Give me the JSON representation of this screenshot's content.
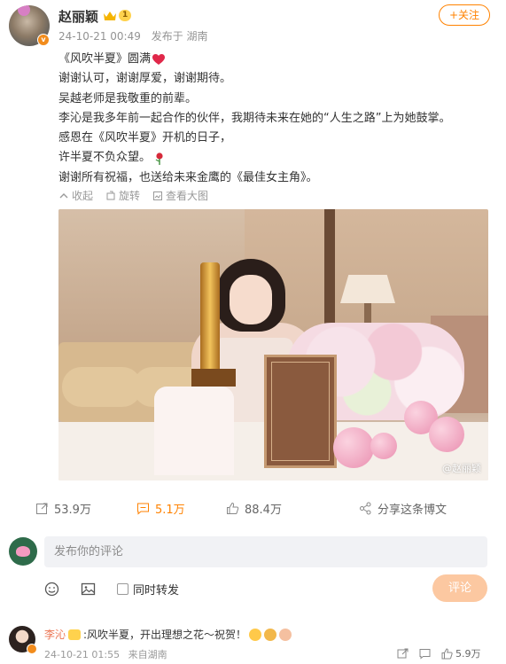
{
  "author": {
    "name": "赵丽颖",
    "vip_level": "1",
    "timestamp": "24-10-21 00:49",
    "location": "发布于 湖南",
    "follow_label": "+关注"
  },
  "post": {
    "lines": [
      "《风吹半夏》圆满",
      "谢谢认可，谢谢厚爱，谢谢期待。",
      "吴越老师是我敬重的前辈。",
      "李沁是我多年前一起合作的伙伴，我期待未来在她的“人生之路”上为她鼓掌。",
      "感恩在《风吹半夏》开机的日子，",
      "许半夏不负众望。",
      "谢谢所有祝福，也送给未来金鹰的《最佳女主角》。"
    ]
  },
  "image_actions": {
    "collapse": "收起",
    "rotate": "旋转",
    "view_large": "查看大图"
  },
  "photo": {
    "watermark": "@赵丽颖"
  },
  "stats": {
    "reposts": "53.9万",
    "comments": "5.1万",
    "likes": "88.4万",
    "share": "分享这条博文"
  },
  "composer": {
    "placeholder": "发布你的评论",
    "repost_also": "同时转发",
    "submit": "评论"
  },
  "reply": {
    "name": "李沁",
    "text": ":风吹半夏，开出理想之花～祝贺！",
    "timestamp": "24-10-21 01:55",
    "location": "来自湖南",
    "likes": "5.9万"
  },
  "colors": {
    "accent": "#ff8200",
    "comment_accent": "#eb7350",
    "heart": "#e0284a"
  }
}
